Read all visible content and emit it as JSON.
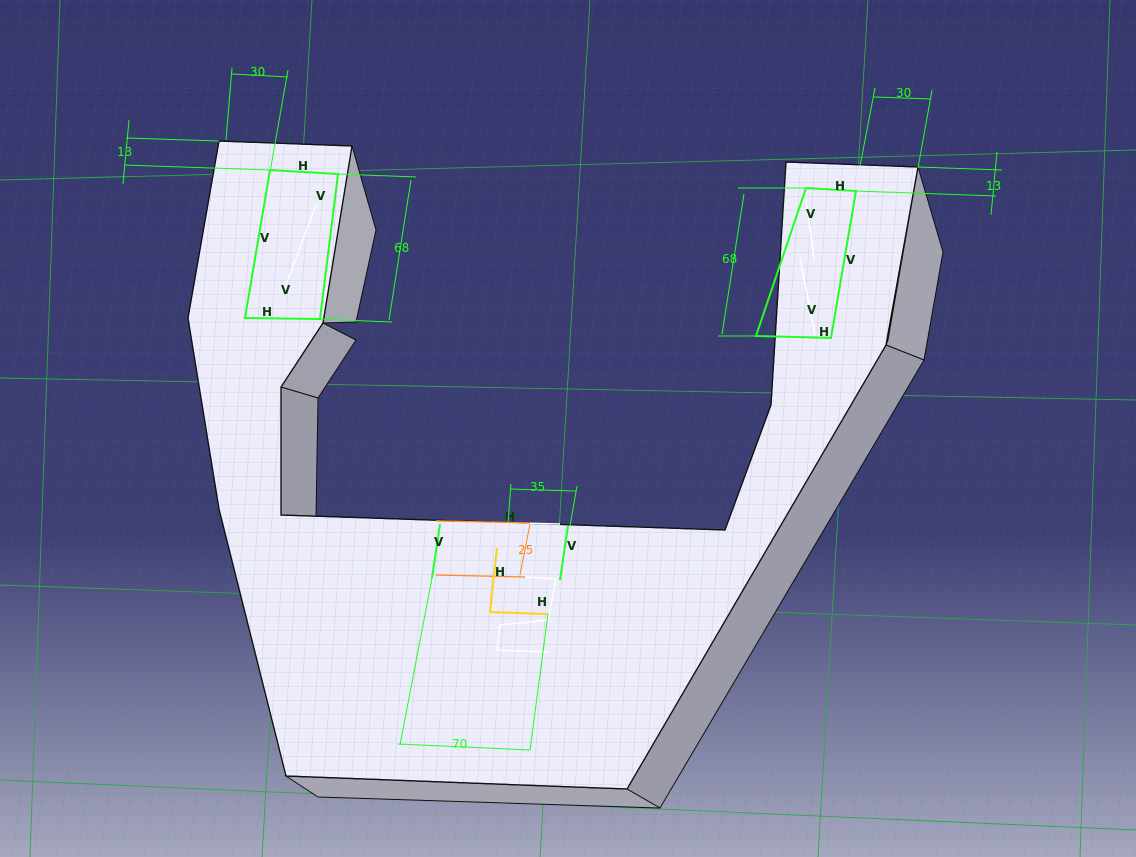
{
  "dimensions": {
    "left_width": "30",
    "right_width": "30",
    "left_offset": "13",
    "right_offset": "13",
    "left_height": "68",
    "right_height": "68",
    "bottom_width": "35",
    "bottom_depth": "25",
    "bottom_length": "70"
  },
  "constraints": {
    "horizontal": "H",
    "vertical": "V"
  },
  "colors": {
    "background_top": "#36376e",
    "background_bottom": "#a6a8c0",
    "grid": "#2fa84a",
    "part_face": "#ececfa",
    "part_side": "#a9a9b4",
    "sketch": "#22ff22",
    "highlight": "#ff8a1a",
    "axis": "#ffd21a"
  }
}
